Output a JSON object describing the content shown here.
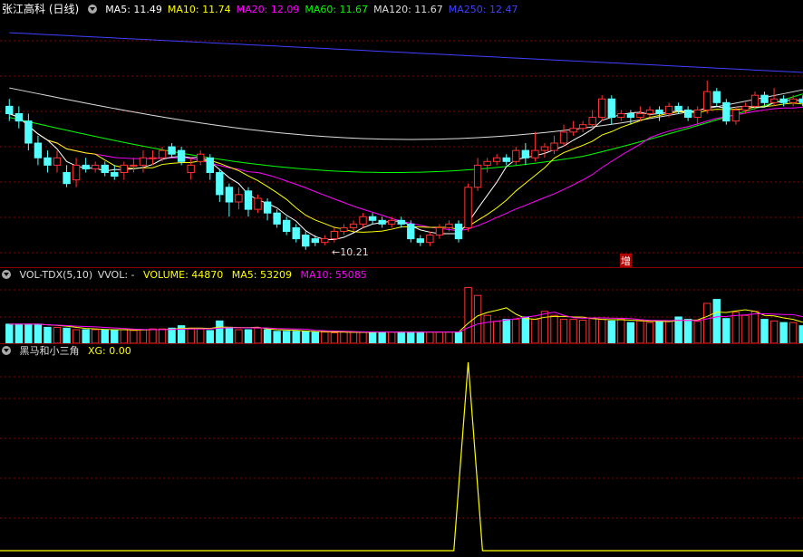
{
  "main_panel": {
    "title": "张江高科 (日线)",
    "indicators": [
      {
        "label": "MA5: 11.49",
        "color": "#ffffff"
      },
      {
        "label": "MA10: 11.74",
        "color": "#ffff00"
      },
      {
        "label": "MA20: 12.09",
        "color": "#ff00ff"
      },
      {
        "label": "MA60: 11.67",
        "color": "#00ff00"
      },
      {
        "label": "MA120: 11.67",
        "color": "#dddddd"
      },
      {
        "label": "MA250: 12.47",
        "color": "#4040ff"
      }
    ],
    "low_annotation": "←10.21",
    "badge": "增"
  },
  "volume_panel": {
    "name": "VOL-TDX(5,10)",
    "vvol": "VVOL: -",
    "volume": "VOLUME: 44870",
    "ma5": "MA5: 53209",
    "ma10": "MA10: 55085"
  },
  "indicator_panel": {
    "name": "黑马和小三角",
    "xg": "XG: 0.00"
  },
  "colors": {
    "up": "#ff3232",
    "down": "#54ffff",
    "grid": "#8b0000",
    "xg_line": "#ffff00"
  },
  "chart_data": {
    "type": "candlestick",
    "price_range": [
      10.0,
      13.2
    ],
    "candles": [
      [
        12.1,
        12.0,
        12.2,
        11.9
      ],
      [
        12.0,
        11.9,
        12.1,
        11.8
      ],
      [
        11.9,
        11.6,
        12.0,
        11.5
      ],
      [
        11.6,
        11.4,
        11.7,
        11.3
      ],
      [
        11.4,
        11.3,
        11.5,
        11.2
      ],
      [
        11.3,
        11.4,
        11.5,
        11.2
      ],
      [
        11.2,
        11.05,
        11.3,
        11.0
      ],
      [
        11.1,
        11.3,
        11.4,
        11.0
      ],
      [
        11.3,
        11.25,
        11.4,
        11.2
      ],
      [
        11.25,
        11.3,
        11.35,
        11.2
      ],
      [
        11.3,
        11.2,
        11.35,
        11.15
      ],
      [
        11.2,
        11.15,
        11.3,
        11.1
      ],
      [
        11.2,
        11.3,
        11.35,
        11.1
      ],
      [
        11.3,
        11.3,
        11.4,
        11.2
      ],
      [
        11.3,
        11.4,
        11.5,
        11.2
      ],
      [
        11.4,
        11.4,
        11.5,
        11.3
      ],
      [
        11.4,
        11.5,
        11.55,
        11.35
      ],
      [
        11.55,
        11.45,
        11.6,
        11.4
      ],
      [
        11.5,
        11.35,
        11.55,
        11.3
      ],
      [
        11.2,
        11.3,
        11.4,
        11.1
      ],
      [
        11.35,
        11.45,
        11.5,
        11.3
      ],
      [
        11.4,
        11.2,
        11.45,
        11.1
      ],
      [
        11.2,
        10.9,
        11.25,
        10.8
      ],
      [
        11.0,
        10.8,
        11.05,
        10.6
      ],
      [
        10.8,
        10.9,
        11.0,
        10.7
      ],
      [
        10.95,
        10.7,
        11.0,
        10.6
      ],
      [
        10.7,
        10.85,
        10.9,
        10.65
      ],
      [
        10.8,
        10.65,
        10.85,
        10.55
      ],
      [
        10.65,
        10.5,
        10.7,
        10.45
      ],
      [
        10.55,
        10.4,
        10.6,
        10.35
      ],
      [
        10.45,
        10.3,
        10.5,
        10.25
      ],
      [
        10.35,
        10.2,
        10.4,
        10.15
      ],
      [
        10.3,
        10.25,
        10.35,
        10.2
      ],
      [
        10.25,
        10.3,
        10.35,
        10.21
      ],
      [
        10.3,
        10.4,
        10.45,
        10.25
      ],
      [
        10.4,
        10.45,
        10.5,
        10.35
      ],
      [
        10.45,
        10.5,
        10.55,
        10.4
      ],
      [
        10.5,
        10.6,
        10.65,
        10.45
      ],
      [
        10.6,
        10.55,
        10.65,
        10.5
      ],
      [
        10.55,
        10.5,
        10.6,
        10.45
      ],
      [
        10.5,
        10.55,
        10.6,
        10.45
      ],
      [
        10.55,
        10.5,
        10.6,
        10.45
      ],
      [
        10.5,
        10.3,
        10.55,
        10.25
      ],
      [
        10.3,
        10.25,
        10.35,
        10.2
      ],
      [
        10.25,
        10.35,
        10.4,
        10.2
      ],
      [
        10.35,
        10.45,
        10.5,
        10.3
      ],
      [
        10.45,
        10.5,
        10.55,
        10.4
      ],
      [
        10.5,
        10.3,
        10.55,
        10.25
      ],
      [
        10.45,
        11.0,
        11.05,
        10.4
      ],
      [
        11.0,
        11.3,
        11.4,
        10.95
      ],
      [
        11.3,
        11.35,
        11.4,
        11.2
      ],
      [
        11.35,
        11.4,
        11.45,
        11.3
      ],
      [
        11.4,
        11.35,
        11.45,
        11.3
      ],
      [
        11.35,
        11.5,
        11.55,
        11.3
      ],
      [
        11.5,
        11.4,
        11.6,
        11.3
      ],
      [
        11.4,
        11.5,
        11.75,
        11.35
      ],
      [
        11.5,
        11.55,
        11.6,
        11.4
      ],
      [
        11.5,
        11.6,
        11.7,
        11.45
      ],
      [
        11.6,
        11.75,
        11.85,
        11.55
      ],
      [
        11.75,
        11.8,
        11.9,
        11.7
      ],
      [
        11.8,
        11.85,
        11.9,
        11.75
      ],
      [
        11.85,
        11.95,
        12.05,
        11.8
      ],
      [
        11.95,
        12.2,
        12.25,
        11.9
      ],
      [
        12.2,
        11.95,
        12.25,
        11.85
      ],
      [
        11.95,
        12.0,
        12.05,
        11.9
      ],
      [
        12.0,
        11.95,
        12.05,
        11.85
      ],
      [
        11.95,
        12.0,
        12.1,
        11.9
      ],
      [
        12.0,
        12.05,
        12.1,
        11.95
      ],
      [
        12.05,
        12.0,
        12.1,
        11.9
      ],
      [
        12.0,
        12.1,
        12.15,
        11.95
      ],
      [
        12.1,
        12.05,
        12.15,
        12.0
      ],
      [
        12.05,
        11.95,
        12.1,
        11.9
      ],
      [
        11.95,
        12.05,
        12.1,
        11.85
      ],
      [
        12.05,
        12.3,
        12.45,
        12.0
      ],
      [
        12.3,
        12.15,
        12.35,
        12.1
      ],
      [
        12.15,
        11.9,
        12.2,
        11.85
      ],
      [
        11.9,
        12.05,
        12.1,
        11.85
      ],
      [
        12.05,
        12.1,
        12.15,
        12.0
      ],
      [
        12.1,
        12.25,
        12.3,
        12.05
      ],
      [
        12.25,
        12.15,
        12.3,
        12.1
      ],
      [
        12.15,
        12.2,
        12.35,
        12.1
      ],
      [
        12.2,
        12.15,
        12.25,
        12.1
      ],
      [
        12.15,
        12.2,
        12.25,
        12.1
      ],
      [
        12.2,
        12.15,
        12.25,
        12.1
      ]
    ],
    "volumes": [
      48,
      48,
      48,
      48,
      40,
      40,
      38,
      34,
      34,
      34,
      34,
      34,
      34,
      32,
      34,
      36,
      36,
      38,
      44,
      36,
      36,
      32,
      56,
      40,
      34,
      34,
      38,
      34,
      30,
      30,
      30,
      30,
      28,
      28,
      26,
      28,
      28,
      28,
      28,
      28,
      28,
      28,
      28,
      28,
      28,
      28,
      28,
      28,
      140,
      120,
      70,
      55,
      60,
      60,
      66,
      60,
      80,
      70,
      60,
      60,
      58,
      62,
      60,
      56,
      60,
      52,
      56,
      52,
      56,
      56,
      66,
      60,
      55,
      100,
      110,
      62,
      78,
      70,
      80,
      60,
      56,
      52,
      52,
      44
    ],
    "xg_signal_index": 48
  }
}
